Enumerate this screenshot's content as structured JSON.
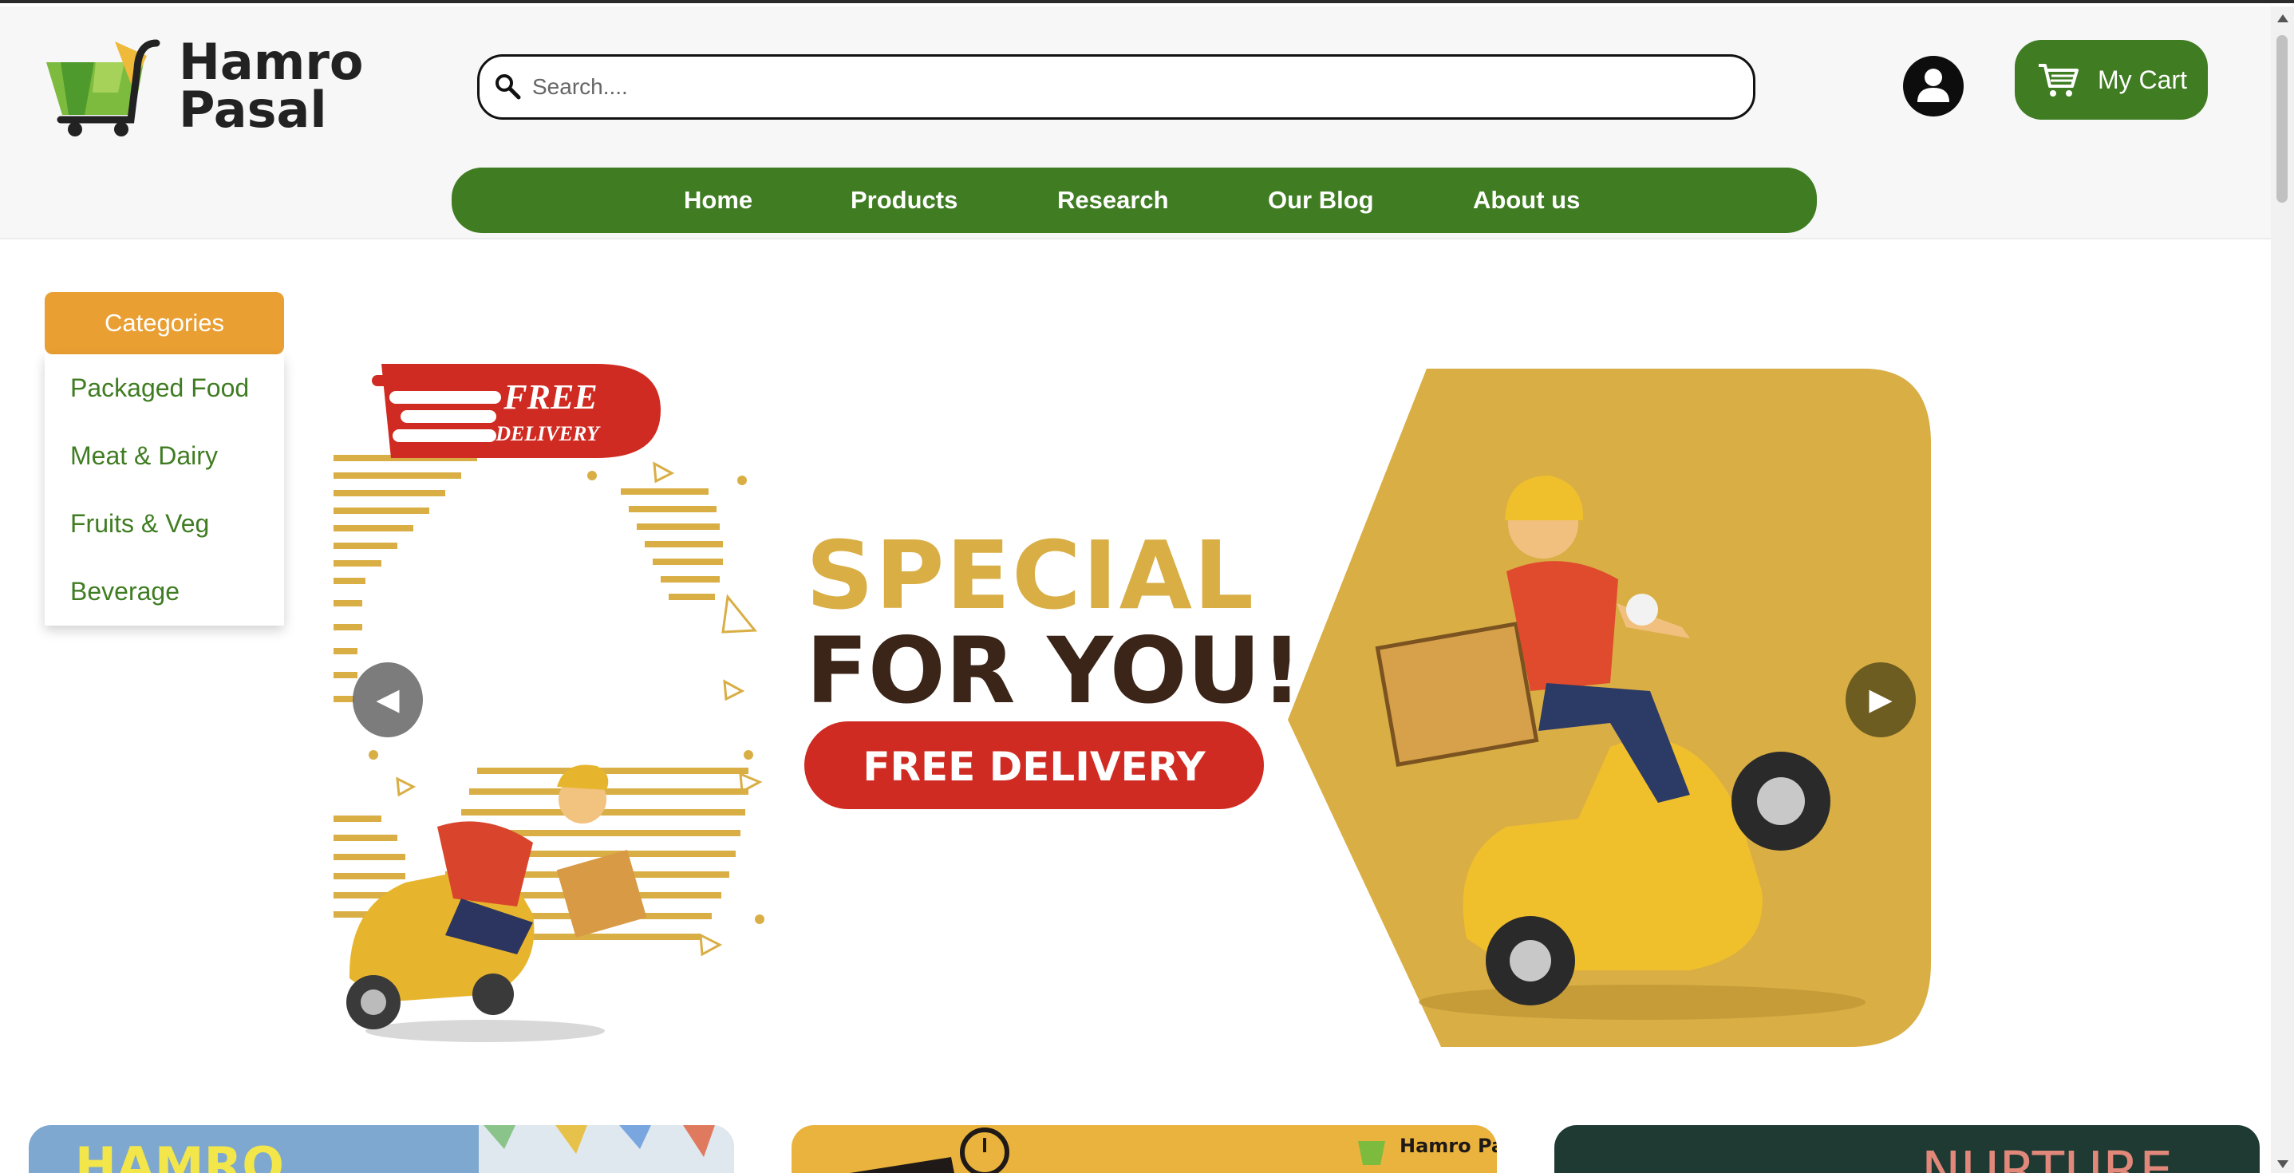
{
  "brand": {
    "name_line1": "Hamro",
    "name_line2": "Pasal"
  },
  "search": {
    "placeholder": "Search...."
  },
  "header": {
    "account_icon": "user-icon",
    "cart_label": "My Cart",
    "cart_icon": "cart-icon"
  },
  "nav": {
    "items": [
      {
        "label": "Home"
      },
      {
        "label": "Products"
      },
      {
        "label": "Research"
      },
      {
        "label": "Our Blog"
      },
      {
        "label": "About us"
      }
    ]
  },
  "categories": {
    "title": "Categories",
    "items": [
      {
        "label": "Packaged Food"
      },
      {
        "label": "Meat & Dairy"
      },
      {
        "label": "Fruits & Veg"
      },
      {
        "label": "Beverage"
      }
    ]
  },
  "banner": {
    "tag_line1": "FREE",
    "tag_line2": "DELIVERY",
    "headline1": "SPECIAL",
    "headline2": "FOR YOU!",
    "cta": "FREE DELIVERY",
    "prev_icon": "arrow-left-icon",
    "next_icon": "arrow-right-icon"
  },
  "promo_cards": [
    {
      "text": "HAMRO"
    },
    {
      "text": "Hamro Pasal"
    },
    {
      "text": "NURTURE"
    }
  ],
  "colors": {
    "brand_green": "#3f7c22",
    "category_orange": "#ea9f32",
    "banner_gold": "#d9ae45",
    "banner_red": "#d02b22",
    "headline_brown": "#3b2418"
  }
}
